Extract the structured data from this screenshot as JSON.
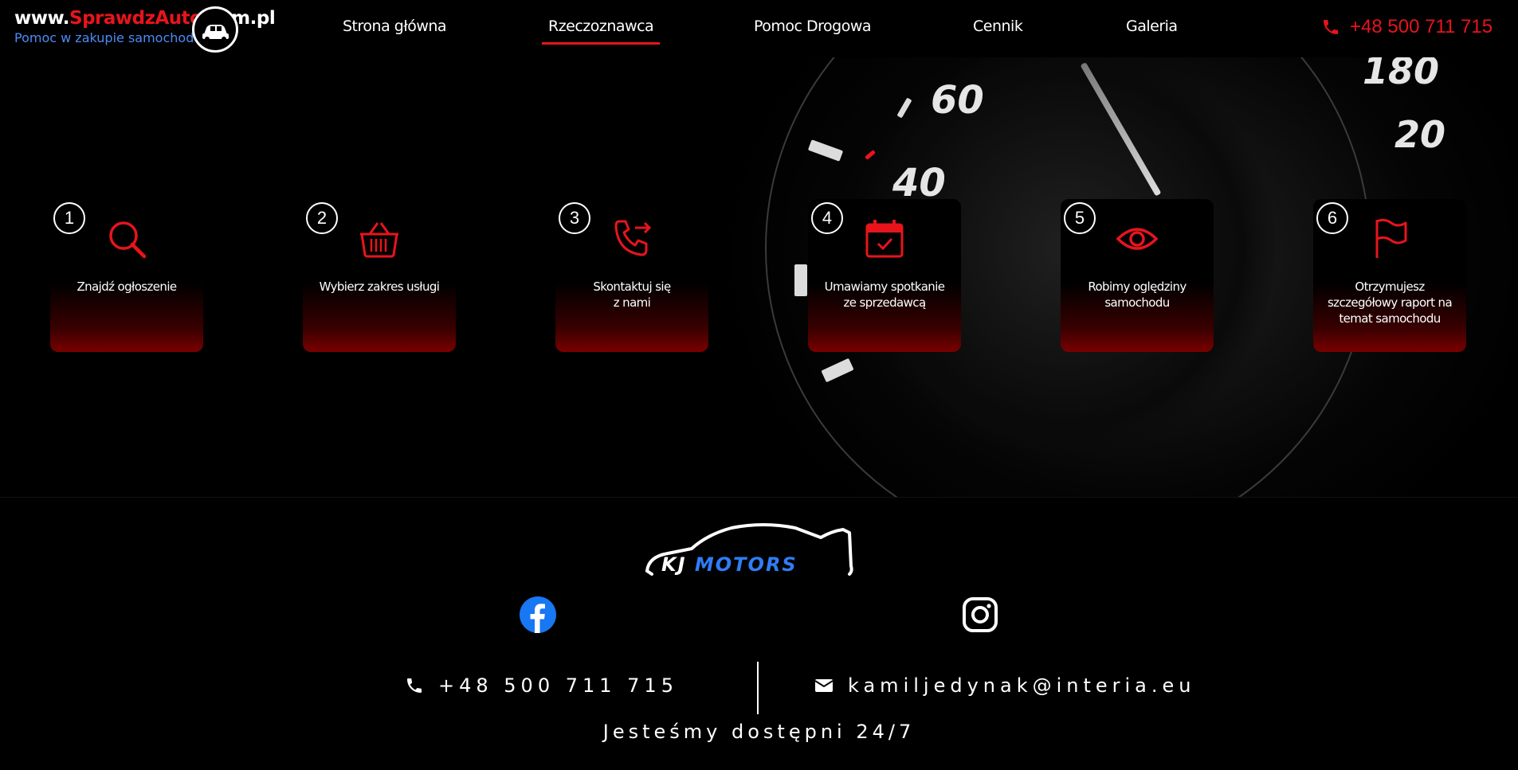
{
  "header": {
    "logo": {
      "prefix": "www.",
      "brand": "SprawdzAuto",
      "suffix": ".com.pl",
      "tagline": "Pomoc w zakupie samochodu"
    },
    "nav": [
      {
        "label": "Strona główna",
        "active": false
      },
      {
        "label": "Rzeczoznawca",
        "active": true
      },
      {
        "label": "Pomoc Drogowa",
        "active": false
      },
      {
        "label": "Cennik",
        "active": false
      },
      {
        "label": "Galeria",
        "active": false
      }
    ],
    "phone": "+48 500 711 715"
  },
  "hero": {
    "gauge_numbers": [
      "60",
      "40",
      "180",
      "20"
    ],
    "steps": [
      {
        "number": "1",
        "icon": "search-icon",
        "line1": "Znajdź ogłoszenie",
        "line2": "",
        "line3": ""
      },
      {
        "number": "2",
        "icon": "basket-icon",
        "line1": "Wybierz zakres usługi",
        "line2": "",
        "line3": ""
      },
      {
        "number": "3",
        "icon": "phone-forward-icon",
        "line1": "Skontaktuj się",
        "line2": "z nami",
        "line3": ""
      },
      {
        "number": "4",
        "icon": "calendar-check-icon",
        "line1": "Umawiamy spotkanie",
        "line2": "ze sprzedawcą",
        "line3": ""
      },
      {
        "number": "5",
        "icon": "eye-icon",
        "line1": "Robimy oględziny",
        "line2": "samochodu",
        "line3": ""
      },
      {
        "number": "6",
        "icon": "flag-icon",
        "line1": "Otrzymujesz",
        "line2": "szczegółowy raport na",
        "line3": "temat samochodu"
      }
    ]
  },
  "footer": {
    "brand_kj": "KJ",
    "brand_motors": "MOTORS",
    "phone": "+48 500 711 715",
    "email": "kamiljedynak@interia.eu",
    "availability": "Jesteśmy dostępni 24/7"
  },
  "colors": {
    "accent": "#e8141c",
    "brand_blue": "#2f7df6",
    "facebook": "#1877f2"
  }
}
